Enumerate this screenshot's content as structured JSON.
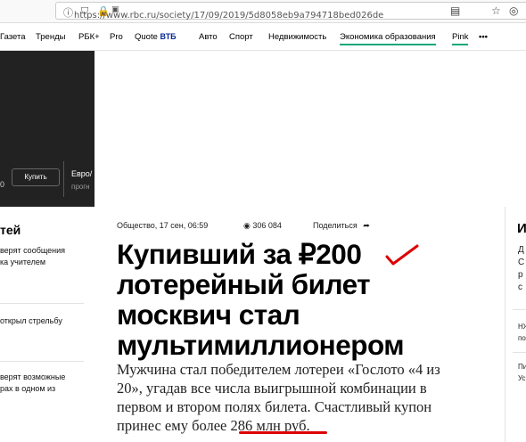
{
  "browser": {
    "url": "https://www.rbc.ru/society/17/09/2019/5d8058eb9a794718bed026de"
  },
  "nav": {
    "items": [
      "Газета",
      "Тренды",
      "РБК+",
      "Pro",
      "Quote",
      "ВТБ",
      "Авто",
      "Спорт",
      "Недвижимость",
      "Экономика образования",
      "Pink",
      "•••"
    ]
  },
  "banner": {
    "zero": "0",
    "buy": "Купить",
    "euro": "Евро/",
    "prog": "прогн"
  },
  "left_col": {
    "title": "тей",
    "news1": [
      "верят сообщения",
      "ка учителем"
    ],
    "news2": [
      "открыл стрельбу"
    ],
    "news3": [
      "верят возможные",
      "рах в одном из"
    ]
  },
  "article": {
    "meta": "Общество, 17 сен, 06:59",
    "views": "306 084",
    "share": "Поделиться",
    "headline": "Купивший за ₽200 лотерейный билет москвич стал мультимиллионером",
    "lead": "Мужчина стал победителем лотереи «Гослото «4 из 20», угадав все числа выигрышной комбинации в первом и втором полях билета. Счастливый купон принес ему более 286 млн руб."
  },
  "right_col": {
    "big": "И",
    "t1": [
      "Д",
      "С",
      "р",
      "с"
    ],
    "t2": [
      "НЖ",
      "по"
    ],
    "t3": [
      "Пи",
      "Ус"
    ]
  },
  "colors": {
    "accent": "#18a97b",
    "dark_banner": "#222222",
    "annotation": "#dd0000"
  }
}
